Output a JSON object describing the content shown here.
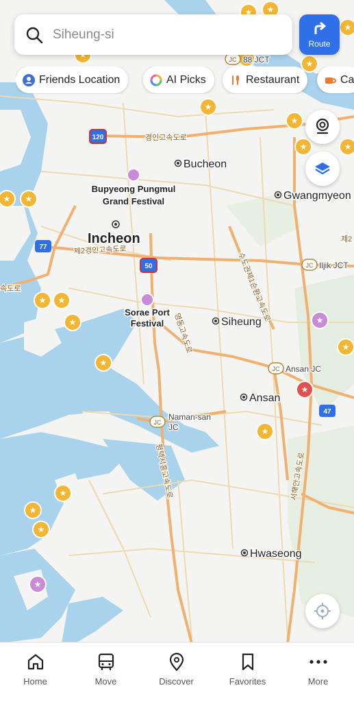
{
  "search": {
    "query": "Siheung-si"
  },
  "route_button": {
    "label": "Route"
  },
  "chips": [
    {
      "label": "Friends Location",
      "icon": "friends-location-icon"
    },
    {
      "label": "AI Picks",
      "icon": "ai-picks-ring-icon"
    },
    {
      "label": "Restaurant",
      "icon": "restaurant-icon"
    },
    {
      "label": "Ca",
      "icon": "cafe-icon"
    }
  ],
  "map": {
    "cities": {
      "incheon": "Incheon",
      "bucheon": "Bucheon",
      "gwangmyeong": "Gwangmyeon",
      "siheung": "Siheung",
      "ansan": "Ansan",
      "hwaseong": "Hwaseong"
    },
    "festivals": {
      "bupyeong_1": "Bupyeong Pungmul",
      "bupyeong_2": "Grand Festival",
      "sorae_1": "Sorae Port",
      "sorae_2": "Festival"
    },
    "junctions": {
      "jct88": "88 JCT",
      "iljik": "Iljik JCT",
      "ansan_jc": "Ansan JC",
      "namansan_1": "Naman-san",
      "namansan_2": "JC",
      "jc_badge": "JC"
    },
    "routes": {
      "r120": "120",
      "r77": "77",
      "r50": "50",
      "r47": "47"
    },
    "road_names": {
      "gyeongin": "경인고속도로",
      "second_gyeongin": "제2경인고속도로",
      "sudogwon": "수도권제1순환고속도로",
      "yeongdong": "영동고속도로",
      "pyeongtaek": "평택시흥고속도로",
      "seohaean": "서해안고속도로",
      "left_edge": "속도로",
      "right_edge": "제2"
    }
  },
  "tabs": [
    {
      "label": "Home",
      "icon": "home-icon"
    },
    {
      "label": "Move",
      "icon": "bus-icon"
    },
    {
      "label": "Discover",
      "icon": "location-pin-icon"
    },
    {
      "label": "Favorites",
      "icon": "bookmark-icon"
    },
    {
      "label": "More",
      "icon": "more-dots-icon"
    }
  ],
  "colors": {
    "water": "#a9d3ec",
    "land": "#f4f4f2",
    "road": "#e9c48a",
    "highway": "#f0b070",
    "accent": "#2f6fe8",
    "star_marker": "#f2b632",
    "festival_marker": "#c98ad6",
    "red_marker": "#e0504f"
  }
}
